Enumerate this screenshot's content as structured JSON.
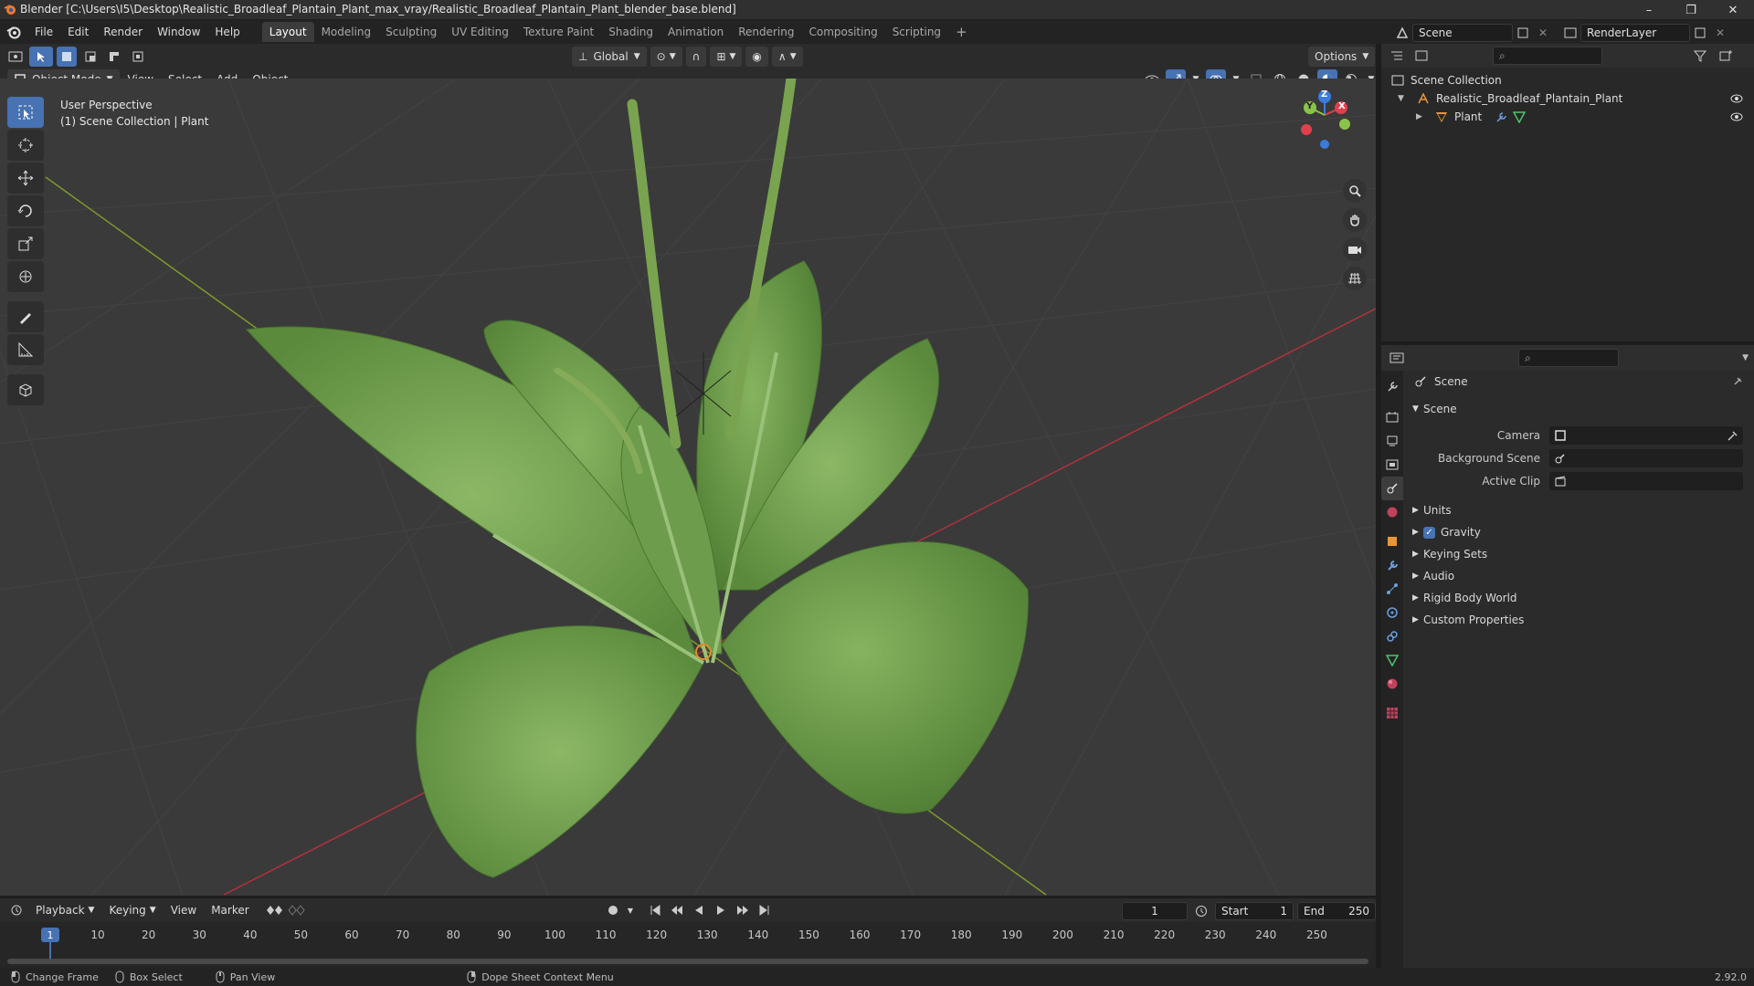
{
  "window": {
    "title": "Blender [C:\\Users\\I5\\Desktop\\Realistic_Broadleaf_Plantain_Plant_max_vray/Realistic_Broadleaf_Plantain_Plant_blender_base.blend]",
    "minimize": "–",
    "maximize": "❐",
    "close": "✕"
  },
  "menu": [
    "File",
    "Edit",
    "Render",
    "Window",
    "Help"
  ],
  "workspaces": [
    "Layout",
    "Modeling",
    "Sculpting",
    "UV Editing",
    "Texture Paint",
    "Shading",
    "Animation",
    "Rendering",
    "Compositing",
    "Scripting"
  ],
  "workspace_add": "+",
  "scene_field": "Scene",
  "renderlayer_field": "RenderLayer",
  "viewport_header": {
    "mode": "Object Mode",
    "menus": [
      "View",
      "Select",
      "Add",
      "Object"
    ],
    "transform_orientation": "Global",
    "options": "Options"
  },
  "viewport": {
    "perspective": "User Perspective",
    "collection_info": "(1) Scene Collection | Plant",
    "gizmo_axes": [
      "X",
      "Y",
      "Z"
    ]
  },
  "outliner": {
    "root": "Scene Collection",
    "items": [
      {
        "label": "Realistic_Broadleaf_Plantain_Plant"
      },
      {
        "label": "Plant"
      }
    ]
  },
  "properties": {
    "header": "Scene",
    "section": "Scene",
    "fields": {
      "camera_label": "Camera",
      "background_scene_label": "Background Scene",
      "active_clip_label": "Active Clip"
    },
    "panels": [
      "Units",
      "Gravity",
      "Keying Sets",
      "Audio",
      "Rigid Body World",
      "Custom Properties"
    ],
    "gravity_checked": true
  },
  "timeline": {
    "menus": [
      "Playback",
      "Keying",
      "View",
      "Marker"
    ],
    "current_frame": "1",
    "start_label": "Start",
    "start_value": "1",
    "end_label": "End",
    "end_value": "250",
    "ruler": [
      "1",
      "10",
      "20",
      "30",
      "40",
      "50",
      "60",
      "70",
      "80",
      "90",
      "100",
      "110",
      "120",
      "130",
      "140",
      "150",
      "160",
      "170",
      "180",
      "190",
      "200",
      "210",
      "220",
      "230",
      "240",
      "250"
    ]
  },
  "statusbar": {
    "items": [
      "Change Frame",
      "Box Select",
      "Pan View",
      "Dope Sheet Context Menu"
    ],
    "version": "2.92.0"
  },
  "colors": {
    "accent": "#4772b3",
    "x_axis": "#e0404c",
    "y_axis": "#8bc34a",
    "z_axis": "#3b7bdc",
    "leaf": "#6a9b4a"
  }
}
